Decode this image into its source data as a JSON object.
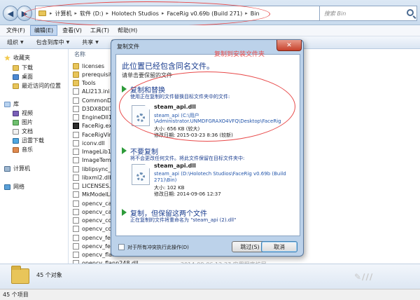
{
  "explorer": {
    "address_crumbs": [
      "计算机",
      "软件 (D:)",
      "Holotech Studios",
      "FaceRig v0.69b (Build 271)",
      "Bin"
    ],
    "search_placeholder": "搜索 Bin",
    "menu": [
      "文件(F)",
      "编辑(E)",
      "查看(V)",
      "工具(T)",
      "帮助(H)"
    ],
    "active_menu": "编辑(E)",
    "commands": [
      "组织",
      "包含到库中",
      "共享",
      "新"
    ],
    "column_header": "名称",
    "sidebar": {
      "favorites_header": "收藏夹",
      "favorites": [
        "下载",
        "桌面",
        "最近访问的位置"
      ],
      "libraries_header": "库",
      "libraries": [
        "视频",
        "图片",
        "文档",
        "迅雷下载",
        "音乐"
      ],
      "computer": "计算机",
      "network": "网络"
    },
    "files": [
      {
        "name": "licenses",
        "type": "folder"
      },
      {
        "name": "prerequisites",
        "type": "folder"
      },
      {
        "name": "Tools",
        "type": "folder"
      },
      {
        "name": "ALI213.ini",
        "type": "file"
      },
      {
        "name": "CommonDll10.",
        "type": "file"
      },
      {
        "name": "D3DX8Dll10.d",
        "type": "file"
      },
      {
        "name": "EngineDll10.",
        "type": "file"
      },
      {
        "name": "FaceRig.exe",
        "type": "exe"
      },
      {
        "name": "FaceRigVirtua",
        "type": "file"
      },
      {
        "name": "iconv.dll",
        "type": "file"
      },
      {
        "name": "ImageLib10.d",
        "type": "file"
      },
      {
        "name": "ImageTemplat",
        "type": "file"
      },
      {
        "name": "liblipsync_rt.d",
        "type": "file"
      },
      {
        "name": "libxml2.dll",
        "type": "file"
      },
      {
        "name": "LICENSES.TXT",
        "type": "file"
      },
      {
        "name": "MkModelLib1",
        "type": "file"
      },
      {
        "name": "opencv_calib",
        "type": "file"
      },
      {
        "name": "opencv_calib",
        "type": "file"
      },
      {
        "name": "opencv_core2",
        "type": "file"
      },
      {
        "name": "opencv_core2",
        "type": "file"
      },
      {
        "name": "opencv_featu",
        "type": "file"
      },
      {
        "name": "opencv_featu",
        "type": "file"
      },
      {
        "name": "opencv_flann",
        "type": "file"
      },
      {
        "name": "opencv_flann248.dll",
        "type": "file"
      }
    ],
    "last_row_meta": "2014-09-06 12:37        应用程序扩展",
    "details_count": "45 个对象",
    "status": "45 个项目",
    "watermark": "✎∕∕∕"
  },
  "dialog": {
    "title": "复制文件",
    "close_label": "✕",
    "heading": "此位置已经包含同名文件。",
    "subheading": "请单击要保留的文件",
    "annotation": "复制到安装文件夹",
    "option_replace": {
      "title": "复制和替换",
      "desc": "使用正在复制的文件替换目标文件夹中的文件:",
      "file_name": "steam_api.dll",
      "path_line1": "steam_api (C:\\用户",
      "path_line2": "\\Administrator.UNMDFGRAXO4VFQ\\Desktop\\FaceRig",
      "size": "大小: 656 KB (较大)",
      "modified": "修改日期: 2015-03-23 8:36 (较新)"
    },
    "option_skip": {
      "title": "不要复制",
      "desc": "将不会更改任何文件。将此文件保留在目标文件夹中:",
      "file_name": "steam_api.dll",
      "path_line1": "steam_api (D:\\Holotech Studios\\FaceRig v0.69b (Build",
      "path_line2": "271)\\Bin)",
      "size": "大小: 102 KB",
      "modified": "修改日期: 2014-09-06 12:37"
    },
    "option_keep_both": {
      "title": "复制，但保留这两个文件",
      "desc": "正在复制的文件将重命名为 \"steam_api (2).dll\""
    },
    "checkbox_label": "对于所有冲突执行此操作(D)",
    "skip_button": "跳过(S)",
    "cancel_button": "取消"
  },
  "colors": {
    "annotation_red": "#e84a4a",
    "dialog_link_blue": "#1a3d8f",
    "option_arrow_green": "#2e9b3a"
  }
}
